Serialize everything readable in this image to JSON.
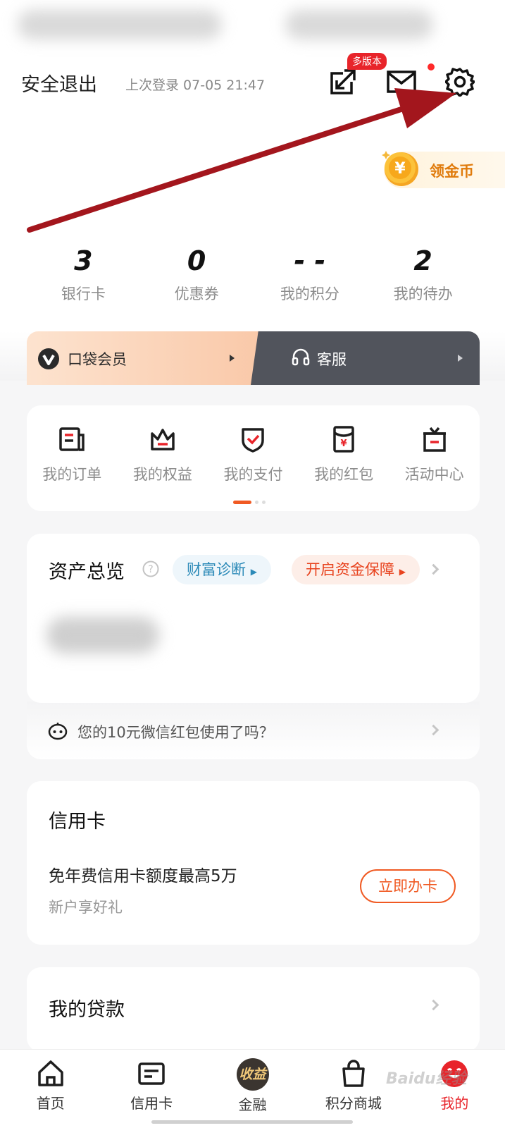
{
  "header": {
    "logout_label": "安全退出",
    "last_login": "上次登录 07-05 21:47",
    "multi_version_badge": "多版本"
  },
  "coin": {
    "label": "领金币"
  },
  "stats": [
    {
      "value": "3",
      "label": "银行卡"
    },
    {
      "value": "0",
      "label": "优惠券"
    },
    {
      "value": "- -",
      "label": "我的积分"
    },
    {
      "value": "2",
      "label": "我的待办"
    }
  ],
  "member_bar": {
    "member_label": "口袋会员",
    "service_label": "客服"
  },
  "quick_links": [
    {
      "label": "我的订单",
      "icon": "order-icon"
    },
    {
      "label": "我的权益",
      "icon": "crown-icon"
    },
    {
      "label": "我的支付",
      "icon": "shield-check-icon"
    },
    {
      "label": "我的红包",
      "icon": "red-packet-icon"
    },
    {
      "label": "活动中心",
      "icon": "gift-icon"
    }
  ],
  "assets": {
    "title": "资产总览",
    "chip_diagnose": "财富诊断",
    "chip_protect": "开启资金保障"
  },
  "tip": {
    "text": "您的10元微信红包使用了吗？"
  },
  "credit_card": {
    "title": "信用卡",
    "headline": "免年费信用卡额度最高5万",
    "subtitle": "新户享好礼",
    "apply_label": "立即办卡"
  },
  "loan": {
    "title": "我的贷款"
  },
  "tabs": [
    {
      "label": "首页",
      "icon": "home-icon"
    },
    {
      "label": "信用卡",
      "icon": "card-icon"
    },
    {
      "label": "金融",
      "icon": "finance-badge-icon",
      "badge": "收益"
    },
    {
      "label": "积分商城",
      "icon": "bag-icon"
    },
    {
      "label": "我的",
      "icon": "profile-icon",
      "active": true
    }
  ],
  "watermark": "Baidu经验",
  "colors": {
    "accent_red": "#e8242a",
    "accent_orange": "#f05a23",
    "arrow": "#a3161d",
    "coin_orange": "#e07b0c"
  }
}
